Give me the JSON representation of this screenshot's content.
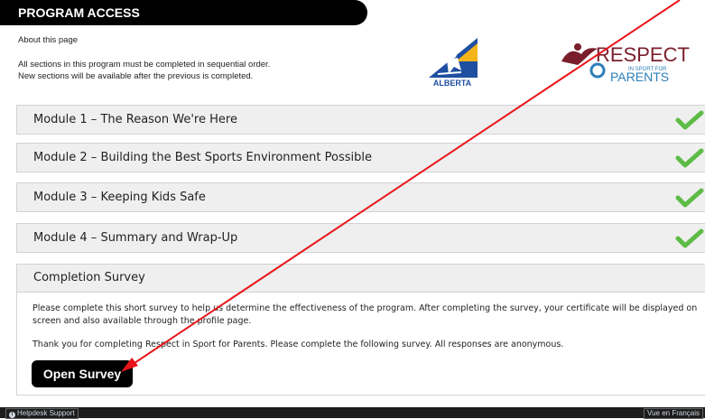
{
  "header": {
    "title": "PROGRAM ACCESS"
  },
  "about": "About this page",
  "intro": {
    "line1": "All sections in this program must be completed in sequential order.",
    "line2": "New sections will be available after the previous is completed."
  },
  "logos": {
    "alberta_text": "ALBERTA",
    "respect_word": "RESPECT",
    "respect_sub": "IN SPORT FOR",
    "respect_parents": "PARENTS"
  },
  "modules": [
    {
      "label": "Module 1 – The Reason We're Here",
      "status": "completed"
    },
    {
      "label": "Module 2 – Building the Best Sports Environment Possible",
      "status": "completed"
    },
    {
      "label": "Module 3 – Keeping Kids Safe",
      "status": "completed"
    },
    {
      "label": "Module 4 – Summary and Wrap-Up",
      "status": "completed"
    }
  ],
  "survey": {
    "heading": "Completion Survey",
    "paragraph1": "Please complete this short survey to help us determine the effectiveness of the program. After completing the survey, your certificate will be displayed on screen and also available through the profile page.",
    "paragraph2": "Thank you for completing Respect in Sport for Parents. Please complete the following survey. All responses are anonymous.",
    "button": "Open Survey"
  },
  "footer": {
    "help_label": "Helpdesk Support",
    "language_label": "Vue en Français"
  },
  "colors": {
    "check_green": "#5dbb46",
    "arrow_red": "#e8161b",
    "respect_red": "#7a1e2b",
    "respect_blue": "#2d7fb8"
  }
}
